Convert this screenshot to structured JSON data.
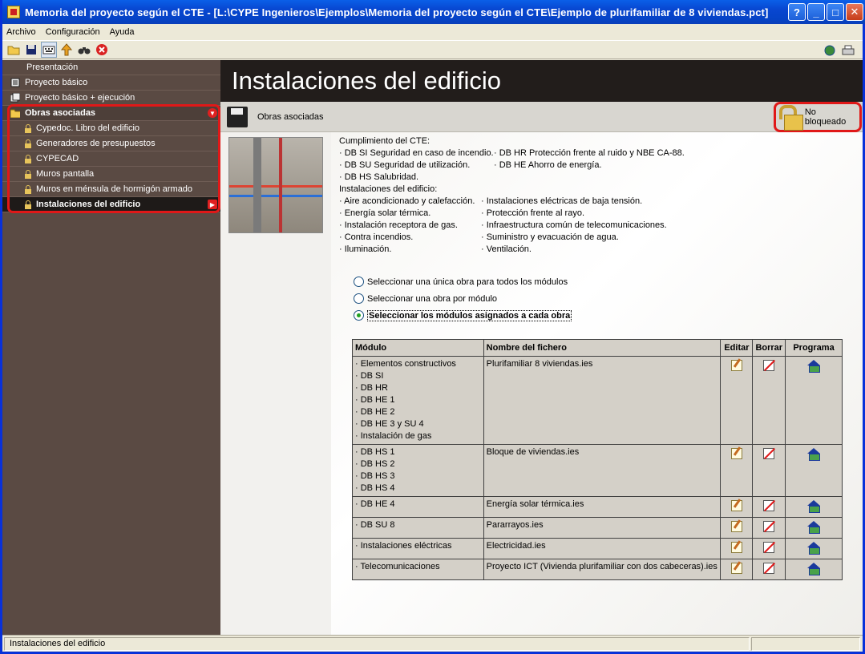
{
  "window": {
    "title": "Memoria del proyecto según el CTE - [L:\\CYPE Ingenieros\\Ejemplos\\Memoria del proyecto según el CTE\\Ejemplo de plurifamiliar de 8 viviendas.pct]",
    "minimize": "_",
    "maximize": "□",
    "close": "✕",
    "help": "?"
  },
  "menu": {
    "archivo": "Archivo",
    "configuracion": "Configuración",
    "ayuda": "Ayuda"
  },
  "sidebar": {
    "items": [
      {
        "label": "Presentación"
      },
      {
        "label": "Proyecto básico"
      },
      {
        "label": "Proyecto básico + ejecución"
      },
      {
        "label": "Obras asociadas"
      },
      {
        "label": "Cypedoc. Libro del edificio"
      },
      {
        "label": "Generadores de presupuestos"
      },
      {
        "label": "CYPECAD"
      },
      {
        "label": "Muros pantalla"
      },
      {
        "label": "Muros en ménsula de hormigón armado"
      },
      {
        "label": "Instalaciones del edificio"
      }
    ]
  },
  "main": {
    "title": "Instalaciones del edificio",
    "subbar_label": "Obras asociadas",
    "lock_label": "No bloqueado",
    "info": {
      "cte_heading": "Cumplimiento del CTE:",
      "cte_col1": [
        "· DB SI Seguridad en caso de incendio.",
        "· DB SU Seguridad de utilización.",
        "· DB HS Salubridad."
      ],
      "cte_col2": [
        "· DB HR Protección frente al ruido y NBE CA-88.",
        "· DB HE Ahorro de energía."
      ],
      "inst_heading": "Instalaciones del edificio:",
      "inst_col1": [
        "· Aire acondicionado y calefacción.",
        "· Energía solar térmica.",
        "· Instalación receptora de gas.",
        "· Contra incendios.",
        "· Iluminación."
      ],
      "inst_col2": [
        "· Instalaciones eléctricas de baja tensión.",
        "· Protección frente al rayo.",
        "· Infraestructura común de telecomunicaciones.",
        "· Suministro y evacuación de agua.",
        "· Ventilación."
      ]
    },
    "radios": [
      {
        "label": "Seleccionar una única obra para todos los módulos",
        "checked": false
      },
      {
        "label": "Seleccionar una obra por módulo",
        "checked": false
      },
      {
        "label": "Seleccionar los módulos asignados a cada obra",
        "checked": true
      }
    ],
    "table": {
      "headers": {
        "modulo": "Módulo",
        "fichero": "Nombre del fichero",
        "editar": "Editar",
        "borrar": "Borrar",
        "programa": "Programa"
      },
      "rows": [
        {
          "modules": [
            "· Elementos constructivos",
            "· DB SI",
            "· DB HR",
            "· DB HE 1",
            "· DB HE 2",
            "· DB HE 3 y SU 4",
            "· Instalación de gas"
          ],
          "file": "Plurifamiliar 8 viviendas.ies"
        },
        {
          "modules": [
            "· DB HS 1",
            "· DB HS 2",
            "· DB HS 3",
            "· DB HS 4"
          ],
          "file": "Bloque de viviendas.ies"
        },
        {
          "modules": [
            "· DB HE 4"
          ],
          "file": "Energía solar térmica.ies"
        },
        {
          "modules": [
            "· DB SU 8"
          ],
          "file": "Pararrayos.ies"
        },
        {
          "modules": [
            "· Instalaciones eléctricas"
          ],
          "file": "Electricidad.ies"
        },
        {
          "modules": [
            "· Telecomunicaciones"
          ],
          "file": "Proyecto ICT (Vivienda plurifamiliar con dos cabeceras).ies"
        }
      ]
    }
  },
  "status": {
    "text": "Instalaciones del edificio"
  },
  "colors": {
    "accent_red": "#e01818",
    "sidebar_bg": "#5a4a43",
    "header_dark": "#221d1b"
  }
}
